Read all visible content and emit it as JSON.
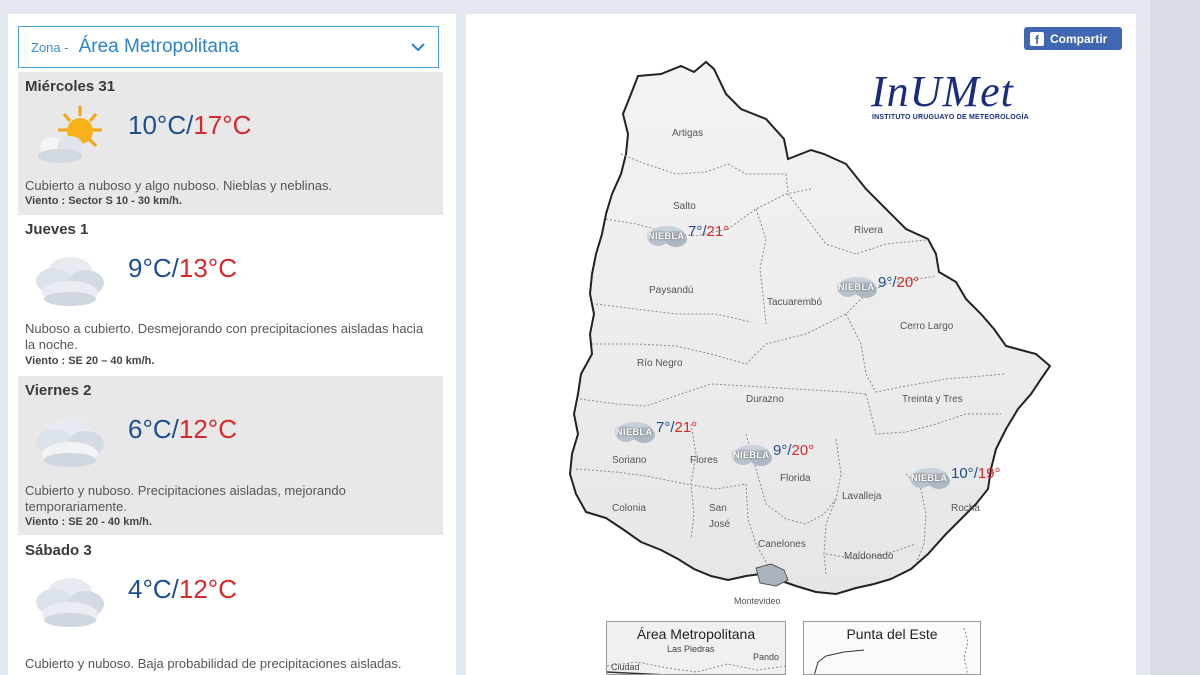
{
  "zone": {
    "label": "Zona -",
    "value": "Área Metropolitana"
  },
  "days": [
    {
      "name": "Miércoles 31",
      "icon": "sun-cloud-icon",
      "min": "10°C",
      "max": "17°C",
      "description": "Cubierto a nuboso y algo nuboso. Nieblas y neblinas.",
      "wind": "Viento : Sector S 10 - 30 km/h."
    },
    {
      "name": "Jueves 1",
      "icon": "clouds-icon",
      "min": "9°C",
      "max": "13°C",
      "description": "Nuboso a cubierto. Desmejorando con precipitaciones aisladas hacia la noche.",
      "wind": "Viento : SE 20 – 40 km/h."
    },
    {
      "name": "Viernes 2",
      "icon": "clouds-icon",
      "min": "6°C",
      "max": "12°C",
      "description": "Cubierto y nuboso. Precipitaciones aisladas, mejorando temporariamente.",
      "wind": "Viento : SE 20 - 40 km/h."
    },
    {
      "name": "Sábado 3",
      "icon": "clouds-icon",
      "min": "4°C",
      "max": "12°C",
      "description": "Cubierto y nuboso. Baja probabilidad de precipitaciones aisladas.",
      "wind": ""
    }
  ],
  "temp_separator": "/",
  "share_label": "Compartir",
  "logo": {
    "title": "InUMet",
    "subtitle": "INSTITUTO URUGUAYO DE METEOROLOGÍA"
  },
  "fog_label": "NIEBLA",
  "departments": {
    "artigas": "Artigas",
    "salto": "Salto",
    "rivera": "Rivera",
    "paysandu": "Paysandú",
    "tacuarembo": "Tacuarembó",
    "cerro_largo": "Cerro Largo",
    "rio_negro": "Río Negro",
    "durazno": "Durazno",
    "treinta_y_tres": "Treinta y Tres",
    "soriano": "Soriano",
    "flores": "Flores",
    "florida": "Florida",
    "lavalleja": "Lavalleja",
    "rocha": "Rocha",
    "colonia": "Colonia",
    "san_jose_1": "San",
    "san_jose_2": "José",
    "canelones": "Canelones",
    "maldonado": "Maldonado",
    "montevideo": "Montevideo"
  },
  "map_forecasts": [
    {
      "region": "salto",
      "min": "7°",
      "max": "21°"
    },
    {
      "region": "tacuarembo",
      "min": "9°",
      "max": "20°"
    },
    {
      "region": "soriano",
      "min": "7°",
      "max": "21°"
    },
    {
      "region": "florida",
      "min": "9°",
      "max": "20°"
    },
    {
      "region": "rocha",
      "min": "10°",
      "max": "19°"
    }
  ],
  "thumbnails": [
    {
      "title": "Área Metropolitana",
      "places": [
        "Las Piedras",
        "Pando",
        "Ciudad"
      ]
    },
    {
      "title": "Punta del Este",
      "places": []
    }
  ]
}
